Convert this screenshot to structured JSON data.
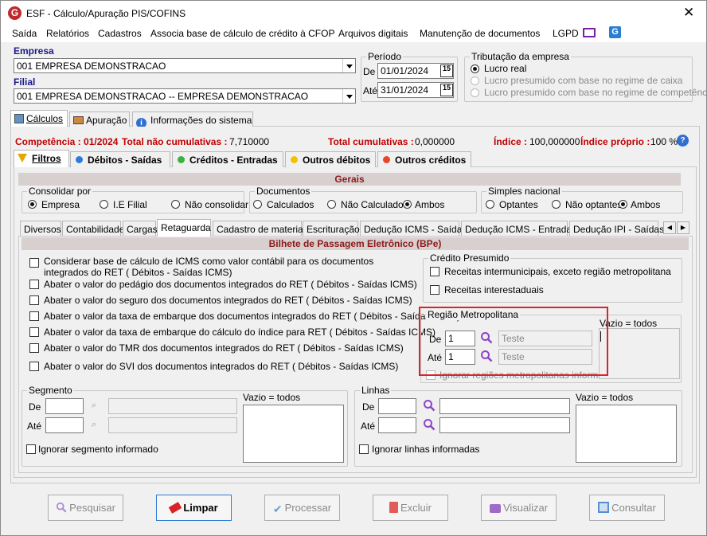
{
  "window": {
    "title": "ESF - Cálculo/Apuração PIS/COFINS"
  },
  "menu": [
    "Saída",
    "Relatórios",
    "Cadastros",
    "Associa base de cálculo de crédito à CFOP",
    "Arquivos digitais",
    "Manutenção de documentos",
    "LGPD"
  ],
  "empresa": {
    "label": "Empresa",
    "value": "001 EMPRESA DEMONSTRACAO"
  },
  "filial": {
    "label": "Filial",
    "value": "001 EMPRESA DEMONSTRACAO -- EMPRESA DEMONSTRACAO"
  },
  "periodo": {
    "title": "Período",
    "de_label": "De",
    "de_value": "01/01/2024",
    "ate_label": "Até",
    "ate_value": "31/01/2024",
    "cal": "15"
  },
  "tributacao": {
    "title": "Tributação da empresa",
    "options": [
      "Lucro real",
      "Lucro presumido com base no regime de caixa",
      "Lucro presumido com base no regime de competência"
    ]
  },
  "main_tabs": [
    "Cálculos",
    "Apuração",
    "Informações do sistema"
  ],
  "status": {
    "competencia": "Competência : 01/2024",
    "total_nao_cum_label": "Total não cumulativas :",
    "total_nao_cum_value": "7,710000",
    "total_cum_label": "Total cumulativas :",
    "total_cum_value": "0,000000",
    "indice_label": "Índice :",
    "indice_value": "100,000000",
    "indice_proprio_label": "Índice próprio :",
    "indice_proprio_value": "100 %"
  },
  "sub_tabs": [
    "Filtros",
    "Débitos - Saídas",
    "Créditos - Entradas",
    "Outros débitos",
    "Outros créditos"
  ],
  "gerais": {
    "title": "Gerais",
    "consolidar": {
      "title": "Consolidar por",
      "options": [
        "Empresa",
        "I.E Filial",
        "Não consolidar"
      ]
    },
    "documentos": {
      "title": "Documentos",
      "options": [
        "Calculados",
        "Não Calculados",
        "Ambos"
      ]
    },
    "simples": {
      "title": "Simples nacional",
      "options": [
        "Optantes",
        "Não optantes",
        "Ambos"
      ]
    }
  },
  "filter_tabs": [
    "Diversos",
    "Contabilidade",
    "Cargas",
    "Retaguarda",
    "Cadastro de materiais",
    "Escrituração",
    "Dedução ICMS - Saídas",
    "Dedução ICMS - Entradas",
    "Dedução IPI - Saídas"
  ],
  "bpe": {
    "title": "Bilhete de Passagem Eletrônico (BPe)",
    "checks": [
      "Considerar base de cálculo de ICMS como valor contábil para os documentos integrados do RET ( Débitos - Saídas ICMS)",
      "Abater o valor do pedágio dos documentos integrados do RET ( Débitos - Saídas ICMS)",
      "Abater o valor do seguro dos documentos integrados do RET ( Débitos - Saídas ICMS)",
      "Abater o valor da taxa de embarque dos documentos integrados do RET ( Débitos - Saídas ICMS)",
      "Abater o valor da taxa de embarque do cálculo do índice para RET ( Débitos - Saídas ICMS)",
      "Abater o valor do TMR dos documentos integrados do RET ( Débitos - Saídas ICMS)",
      "Abater o valor do SVI dos documentos integrados do RET ( Débitos - Saídas ICMS)"
    ],
    "credito": {
      "title": "Crédito Presumido",
      "checks": [
        "Receitas intermunicipais, exceto região metropolitana",
        "Receitas interestaduais"
      ]
    },
    "regiao": {
      "title": "Região Metropolitana",
      "de_label": "De",
      "de_value": "1",
      "de_desc": "Teste",
      "ate_label": "Até",
      "ate_value": "1",
      "ate_desc": "Teste",
      "ignore": "Ignorar regiões metropolitanas informadas",
      "vazio": "Vazio = todos"
    }
  },
  "segmento": {
    "title": "Segmento",
    "de": "De",
    "ate": "Até",
    "ignore": "Ignorar segmento informado",
    "vazio": "Vazio = todos"
  },
  "linhas": {
    "title": "Linhas",
    "de": "De",
    "ate": "Até",
    "ignore": "Ignorar linhas informadas",
    "vazio": "Vazio = todos"
  },
  "buttons": [
    "Pesquisar",
    "Limpar",
    "Processar",
    "Excluir",
    "Visualizar",
    "Consultar"
  ],
  "colors": {
    "accent": "#1a1a8a",
    "red": "#c00000",
    "highlight": "#d9232d"
  }
}
